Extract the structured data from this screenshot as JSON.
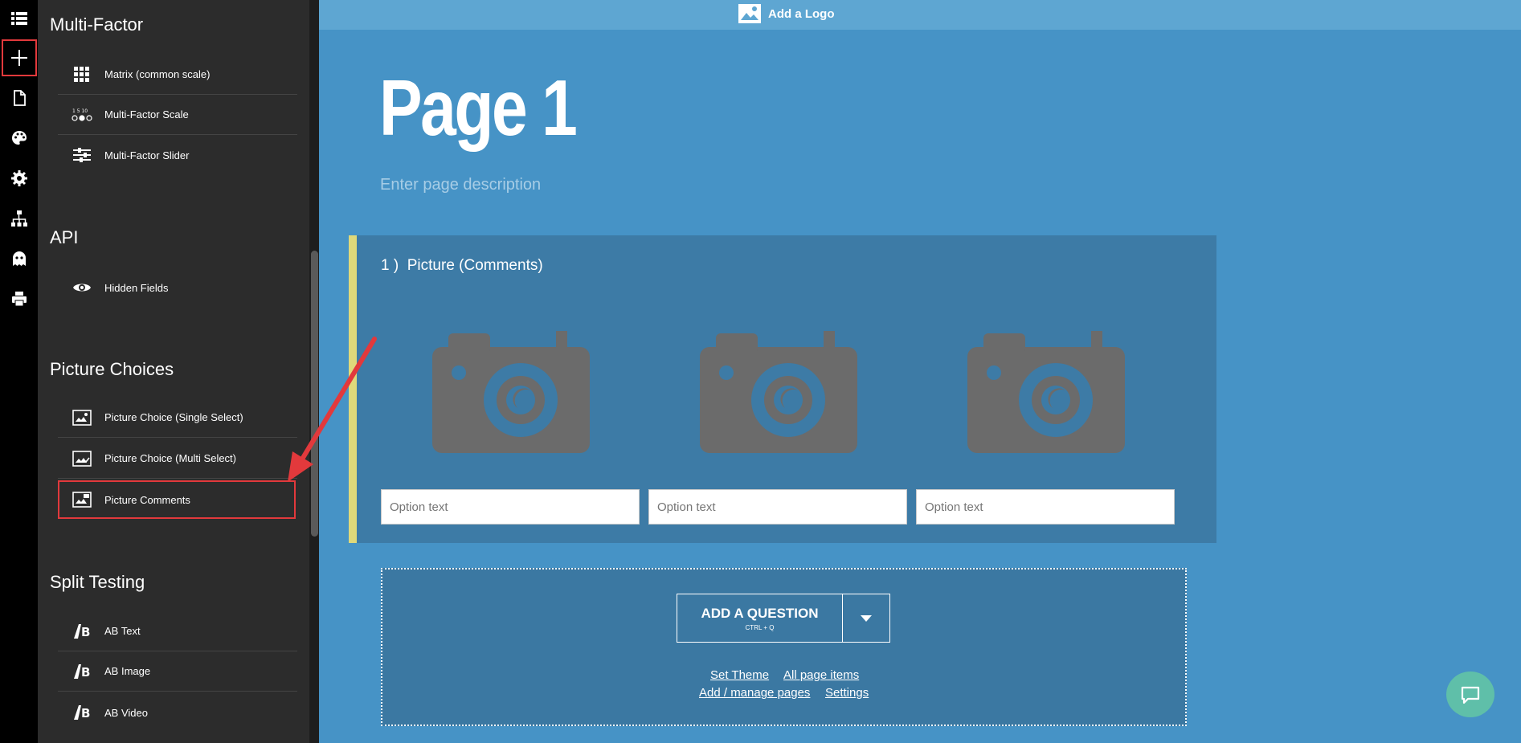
{
  "rail": {
    "icons": [
      "list-icon",
      "plus-icon",
      "page-icon",
      "palette-icon",
      "gear-icon",
      "sitemap-icon",
      "ghost-icon",
      "print-icon"
    ]
  },
  "sidebar": {
    "sections": [
      {
        "title": "Multi-Factor",
        "items": [
          "Matrix (common scale)",
          "Multi-Factor Scale",
          "Multi-Factor Slider"
        ]
      },
      {
        "title": "API",
        "items": [
          "Hidden Fields"
        ]
      },
      {
        "title": "Picture Choices",
        "items": [
          "Picture Choice (Single Select)",
          "Picture Choice (Multi Select)",
          "Picture Comments"
        ]
      },
      {
        "title": "Split Testing",
        "items": [
          "AB Text",
          "AB Image",
          "AB Video"
        ]
      }
    ],
    "highlighted_item": "Picture Comments"
  },
  "header": {
    "add_logo": "Add a Logo"
  },
  "page": {
    "title": "Page 1",
    "description_placeholder": "Enter page description"
  },
  "question": {
    "number": "1 )",
    "title": "Picture (Comments)",
    "options": [
      {
        "placeholder": "Option text"
      },
      {
        "placeholder": "Option text"
      },
      {
        "placeholder": "Option text"
      }
    ]
  },
  "add_question": {
    "label": "ADD A QUESTION",
    "shortcut": "CTRL + Q",
    "links": [
      "Set Theme",
      "All page items",
      "Add / manage pages",
      "Settings"
    ]
  },
  "colors": {
    "accent_red": "#e2393c",
    "main_bg": "#4693c6",
    "question_bar": "#dfd97a",
    "chat_button": "#5fbfa9"
  }
}
